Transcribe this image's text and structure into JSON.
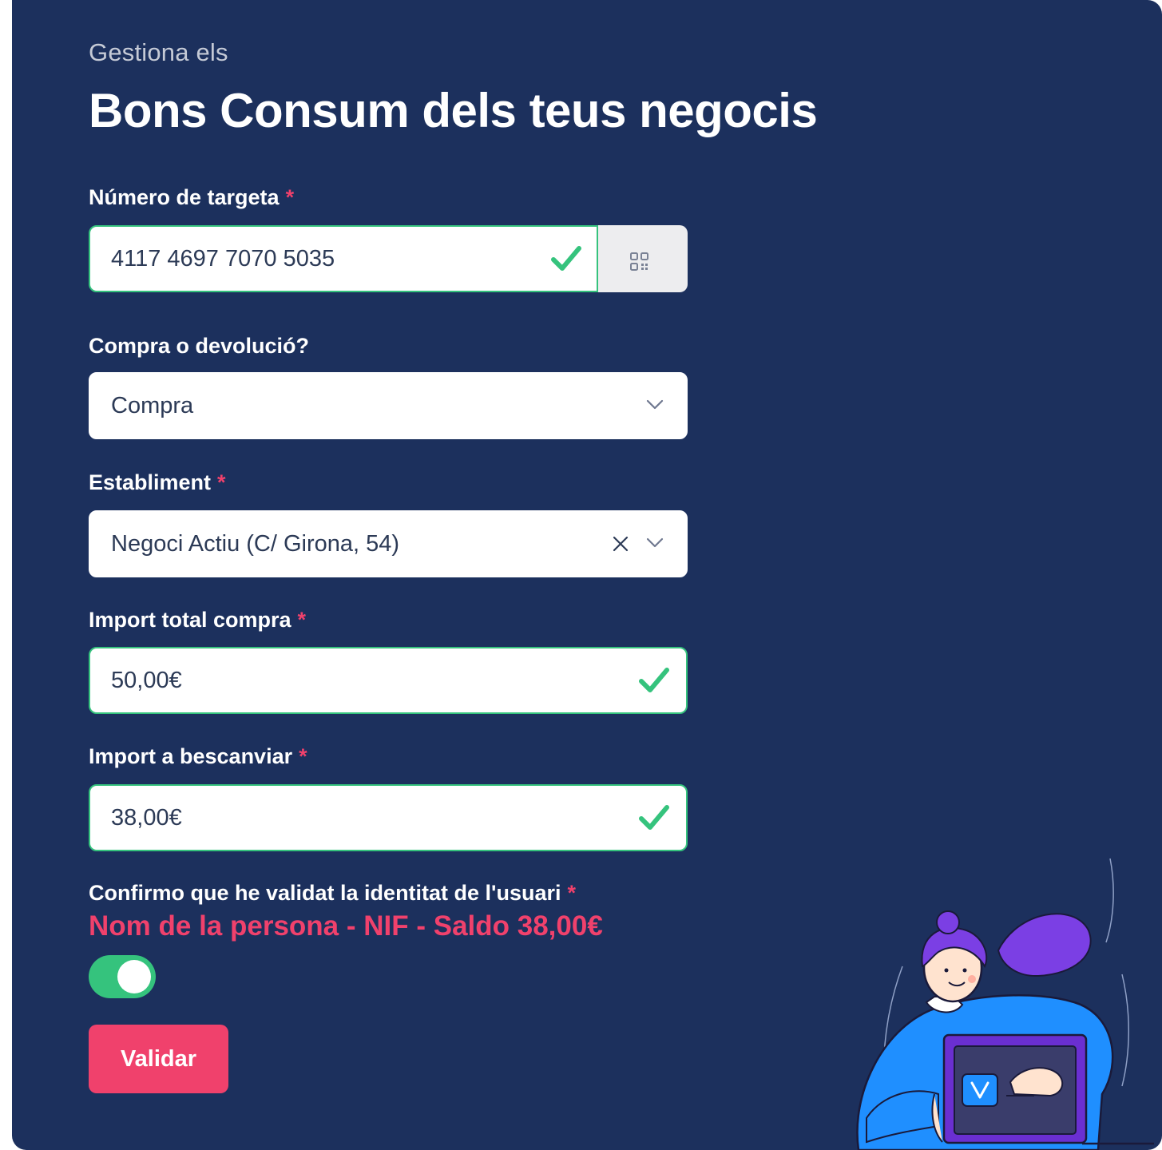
{
  "header": {
    "subtitle": "Gestiona els",
    "title": "Bons Consum dels teus negocis"
  },
  "form": {
    "card_number": {
      "label": "Número de targeta",
      "required_mark": "*",
      "value": "4117 4697 7070 5035",
      "status_icon": "check-icon",
      "scan_icon": "qr-code-icon"
    },
    "operation": {
      "label": "Compra o devolució?",
      "value": "Compra",
      "icon": "chevron-down-icon"
    },
    "establishment": {
      "label": "Establiment",
      "required_mark": "*",
      "value": "Negoci Actiu (C/ Girona, 54)",
      "icons": [
        "close-icon",
        "chevron-down-icon"
      ]
    },
    "total_amount": {
      "label": "Import total compra",
      "required_mark": "*",
      "value": "50,00€",
      "status_icon": "check-icon"
    },
    "redeem_amount": {
      "label": "Import a bescanviar",
      "required_mark": "*",
      "value": "38,00€",
      "status_icon": "check-icon"
    },
    "confirm_identity": {
      "label": "Confirmo que he validat la identitat de l'usuari",
      "required_mark": "*",
      "user_info": "Nom de la persona -  NIF - Saldo 38,00€",
      "toggle_on": true
    },
    "submit_label": "Validar"
  },
  "colors": {
    "background": "#1c305d",
    "accent": "#f0416c",
    "success": "#35c37d",
    "text": "#ffffff"
  }
}
